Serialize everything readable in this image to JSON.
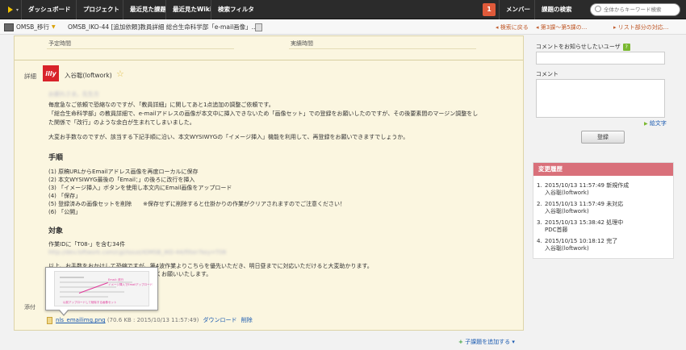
{
  "nav": {
    "items": [
      "ダッシュボード",
      "プロジェクト",
      "最近見た課題",
      "最近見たWiki",
      "検索フィルタ"
    ],
    "notification_count": "1",
    "member_label": "メンバー",
    "issue_search_label": "課題の検索",
    "search_placeholder": "全体からキーワード検索"
  },
  "breadcrumb": {
    "project": "OMSB_移行",
    "issue": "OMSB_IKO-44 [追加依頼]教員詳細 総合生命科学部「e-mail画像」...",
    "back_to_search": "検索に戻る",
    "page_position": "第3課〜第5課の...",
    "list_position": "リスト部分の対応..."
  },
  "issue": {
    "planned_time_label": "予定時間",
    "actual_time_label": "実績時間",
    "detail_label": "詳細",
    "author_logo": "illy",
    "author": "入谷聡(loftwork)",
    "greeting": "お疲れさま。先生方",
    "paragraph1": [
      "毎度急なご依頼で恐縮なのですが、「教員詳細」に関してあと1点追加の調整ご依頼です。",
      "「総合生命科学部」の教員詳細で、e-mailアドレスの画像が本文中に挿入できないため「画像セット」での登録をお願いしたのですが、その後要素間のマージン調整をし",
      "た関係で「改行」のような余白が生まれてしまいました。"
    ],
    "paragraph2": "大変お手数なのですが、該当する下記手順に沿い、本文WYSIWYGの「イメージ挿入」機能を利用して、再登録をお願いできますでしょうか。",
    "steps_heading": "手順",
    "steps": [
      "(1) 原稿URLからEmailアドレス画像を再度ローカルに保存",
      "(2) 本文WYSIWYG最後の「Email：」の後ろに改行を挿入",
      "(3) 「イメージ挿入」ボタンを使用し本文内にEmail画像をアップロード",
      "(4) 「保存」",
      "(5) 登録済みの画像セットを削除　　※保存せずに削除すると仕掛かりの作業がクリアされますのでご注意ください！",
      "(6) 「公開」"
    ],
    "target_heading": "対象",
    "target_text": "作業IDに「T08-」を含む34件",
    "target_url": "http://dev.loftwork.com/cgi/issue/IOMSB_IKO-44/filter?key=T08",
    "closing1_visible": "以上、お手数をおかけして恐縮ですが、第4波作業よりこちらを優先いただき、明日昼までに対応いただけると大変助かります。",
    "closing2_visible": "何卒よろしくお願いいたします。",
    "attachment_label": "添付",
    "attachment": {
      "filename": "nls_emailimg.png",
      "meta": "(70.6 KB : 2015/10/13 11:57:49)",
      "download_label": "ダウンロード",
      "delete_label": "削除"
    },
    "thumbnail": {
      "note1": "Email: 改行",
      "note2": "イメージ挿入でEmailアップロード",
      "note3": "以前アップロードして削除する画像セット"
    }
  },
  "add_child_label": "子課題を追加する",
  "sidebar": {
    "notify_label": "コメントをお知らせしたいユーザ",
    "notify_help": "?",
    "comment_label": "コメント",
    "pictograph_label": "絵文字",
    "register_label": "登録",
    "history_title": "変更履歴",
    "history": [
      {
        "num": "1.",
        "line1": "2015/10/13 11:57:49 新規作成",
        "line2": "入谷聡(loftwork)"
      },
      {
        "num": "2.",
        "line1": "2015/10/13 11:57:49 未対応",
        "line2": "入谷聡(loftwork)"
      },
      {
        "num": "3.",
        "line1": "2015/10/13 15:38:42 処理中",
        "line2": "PDC首藤"
      },
      {
        "num": "4.",
        "line1": "2015/10/15 10:18:12 完了",
        "line2": "入谷聡(loftwork)"
      }
    ]
  },
  "colors": {
    "nav_bg": "#2b2b2b",
    "main_bg": "#fbf6e0",
    "history_header": "#d9707a",
    "badge": "#e05a3a",
    "link": "#1a5ab0"
  }
}
